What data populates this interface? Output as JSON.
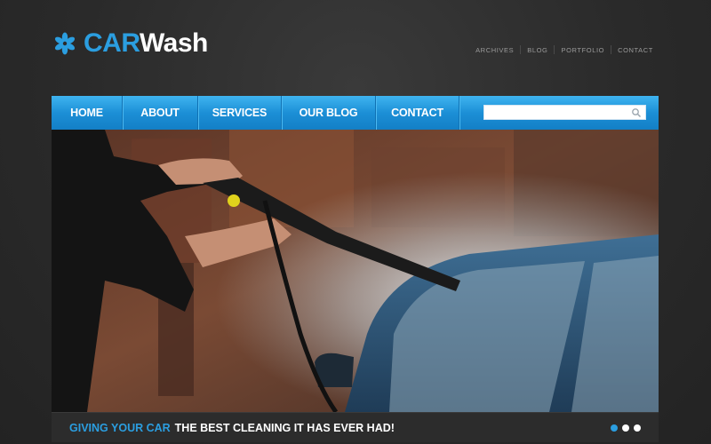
{
  "brand": {
    "name_part1": "CAR",
    "name_part2": "Wash",
    "accent_color": "#2b9ee0"
  },
  "top_links": [
    "ARCHIVES",
    "BLOG",
    "PORTFOLIO",
    "CONTACT"
  ],
  "nav": {
    "items": [
      "HOME",
      "ABOUT",
      "SERVICES",
      "OUR BLOG",
      "CONTACT"
    ],
    "search_placeholder": "",
    "search_icon": "search-icon"
  },
  "hero": {
    "image_subject": "man pressure washing a blue car"
  },
  "caption": {
    "highlight": "GIVING YOUR CAR",
    "rest": "THE BEST CLEANING IT HAS EVER HAD!"
  },
  "slider": {
    "dot_count": 3,
    "active_index": 0
  }
}
